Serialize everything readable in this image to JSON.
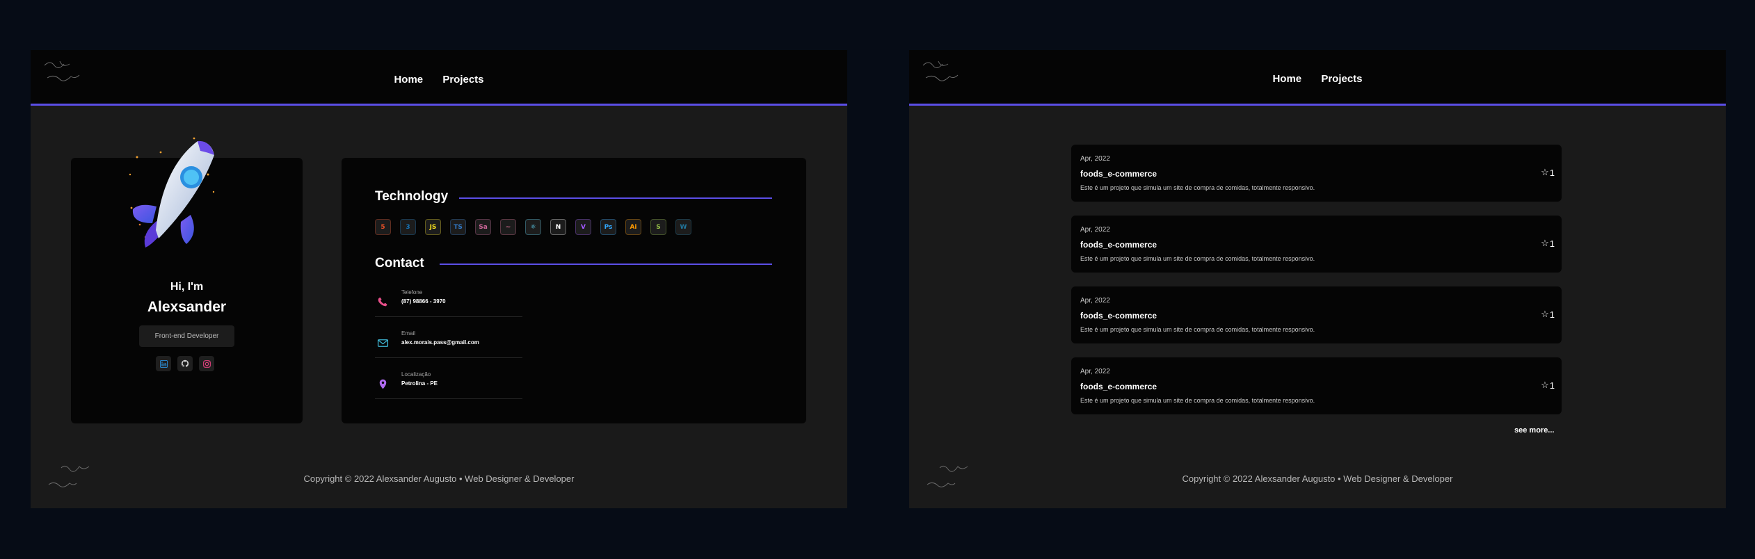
{
  "nav": {
    "home": "Home",
    "projects": "Projects"
  },
  "profile": {
    "greeting": "Hi, I'm",
    "name": "Alexsander",
    "role": "Front-end Developer",
    "socials": [
      "linkedin-icon",
      "github-icon",
      "instagram-icon"
    ]
  },
  "technology": {
    "title": "Technology",
    "items": [
      {
        "label": "5",
        "icon": "html5-icon",
        "color": "#e34f26"
      },
      {
        "label": "3",
        "icon": "css3-icon",
        "color": "#1572b6"
      },
      {
        "label": "JS",
        "icon": "javascript-icon",
        "color": "#f7df1e"
      },
      {
        "label": "TS",
        "icon": "typescript-icon",
        "color": "#3178c6"
      },
      {
        "label": "Sa",
        "icon": "sass-icon",
        "color": "#cc6699"
      },
      {
        "label": "~",
        "icon": "styled-components-icon",
        "color": "#db7093"
      },
      {
        "label": "⚛",
        "icon": "react-icon",
        "color": "#61dafb"
      },
      {
        "label": "N",
        "icon": "nextjs-icon",
        "color": "#ffffff"
      },
      {
        "label": "V",
        "icon": "vite-icon",
        "color": "#a259ff"
      },
      {
        "label": "Ps",
        "icon": "photoshop-icon",
        "color": "#31a8ff"
      },
      {
        "label": "Ai",
        "icon": "illustrator-icon",
        "color": "#ff9a00"
      },
      {
        "label": "S",
        "icon": "shopify-icon",
        "color": "#95bf47"
      },
      {
        "label": "W",
        "icon": "wordpress-icon",
        "color": "#21759b"
      }
    ]
  },
  "contact": {
    "title": "Contact",
    "items": [
      {
        "label": "Telefone",
        "value": "(87) 98866 - 3970",
        "icon": "phone-icon",
        "color": "#e84f8a"
      },
      {
        "label": "Email",
        "value": "alex.morais.pass@gmail.com",
        "icon": "mail-icon",
        "color": "#3fb8d6"
      },
      {
        "label": "Localização",
        "value": "Petrolina - PE",
        "icon": "location-icon",
        "color": "#b06bf0"
      }
    ]
  },
  "projects": [
    {
      "date": "Apr, 2022",
      "name": "foods_e-commerce",
      "description": "Este é um projeto que simula um site de compra de comidas, totalmente responsivo.",
      "stars": "1"
    },
    {
      "date": "Apr, 2022",
      "name": "foods_e-commerce",
      "description": "Este é um projeto que simula um site de compra de comidas, totalmente responsivo.",
      "stars": "1"
    },
    {
      "date": "Apr, 2022",
      "name": "foods_e-commerce",
      "description": "Este é um projeto que simula um site de compra de comidas, totalmente responsivo.",
      "stars": "1"
    },
    {
      "date": "Apr, 2022",
      "name": "foods_e-commerce",
      "description": "Este é um projeto que simula um site de compra de comidas, totalmente responsivo.",
      "stars": "1"
    }
  ],
  "see_more": "see more...",
  "footer": {
    "copyright": "Copyright © 2022 Alexsander Augusto • Web Designer & Developer"
  },
  "colors": {
    "accent": "#5b4ee6",
    "card": "#050505",
    "page": "#1a1a1a"
  }
}
